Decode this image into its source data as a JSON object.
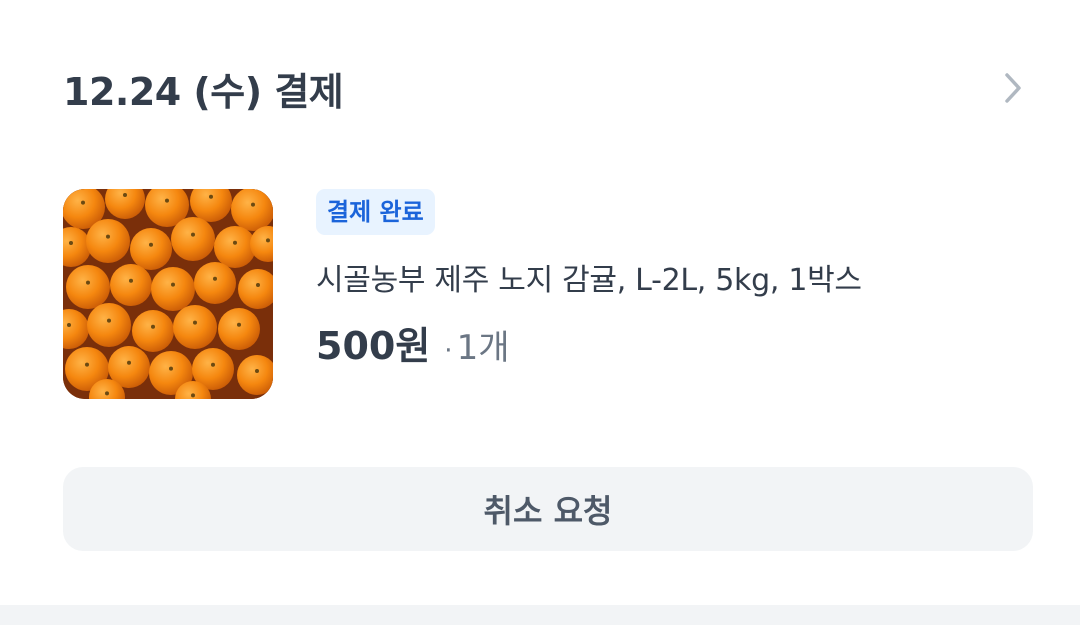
{
  "order": {
    "date_title": "12.24 (수) 결제",
    "chevron_icon": "chevron-right-icon"
  },
  "item": {
    "image_icon": "tangerine-photo",
    "status_badge": "결제 완료",
    "name": "시골농부 제주 노지 감귤, L-2L, 5kg, 1박스",
    "price": "500원",
    "separator": "·",
    "quantity": "1개"
  },
  "actions": {
    "cancel_label": "취소 요청"
  },
  "colors": {
    "accent": "#1b64da",
    "badge_bg": "#e8f3ff",
    "button_bg": "#f2f4f6",
    "text_primary": "#333d4b",
    "text_secondary": "#6b7684"
  }
}
